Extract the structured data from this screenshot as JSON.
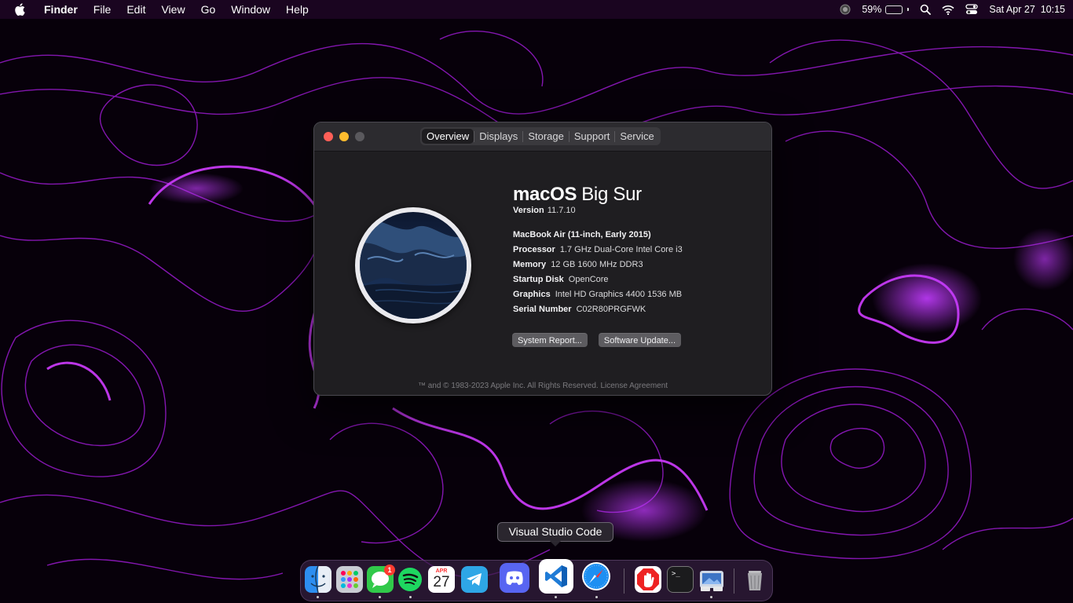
{
  "menubar": {
    "app_name": "Finder",
    "menus": [
      "File",
      "Edit",
      "View",
      "Go",
      "Window",
      "Help"
    ],
    "battery_percent": "59%",
    "battery_level": 0.59,
    "clock": "Sat Apr 27  10:15"
  },
  "window": {
    "tabs": [
      "Overview",
      "Displays",
      "Storage",
      "Support",
      "Service"
    ],
    "active_tab": "Overview",
    "os_name": "macOS",
    "os_version_name": "Big Sur",
    "version_label": "Version",
    "version": "11.7.10",
    "model": "MacBook Air (11-inch, Early 2015)",
    "specs": [
      {
        "label": "Processor",
        "value": "1.7 GHz Dual-Core Intel Core i3"
      },
      {
        "label": "Memory",
        "value": "12 GB 1600 MHz DDR3"
      },
      {
        "label": "Startup Disk",
        "value": "OpenCore"
      },
      {
        "label": "Graphics",
        "value": "Intel HD Graphics 4400 1536 MB"
      },
      {
        "label": "Serial Number",
        "value": "C02R80PRGFWK"
      }
    ],
    "buttons": {
      "system_report": "System Report...",
      "software_update": "Software Update..."
    },
    "footer": "™ and © 1983-2023 Apple Inc. All Rights Reserved. License Agreement"
  },
  "tooltip": "Visual Studio Code",
  "dock": {
    "messages_badge": "1",
    "calendar_month": "APR",
    "calendar_day": "27",
    "terminal_prompt": ">_"
  },
  "colors": {
    "accent_purple": "#b020e8",
    "close": "#ff5f57",
    "minimize": "#febc2e"
  }
}
